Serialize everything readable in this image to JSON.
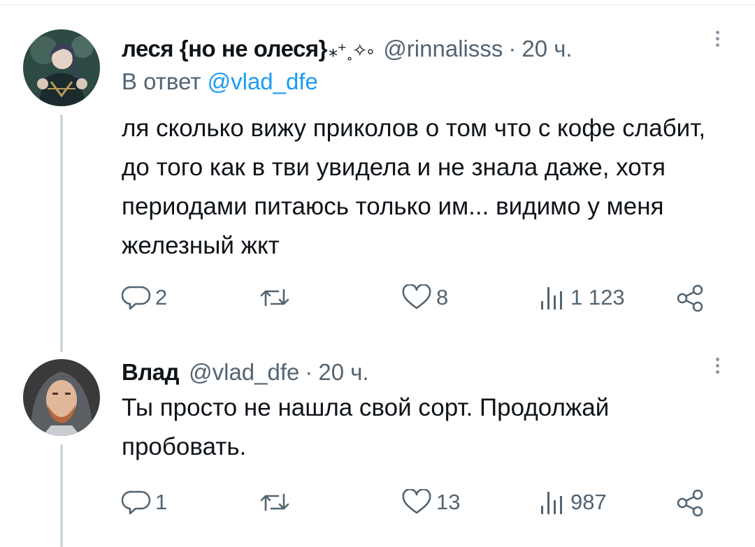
{
  "tweets": [
    {
      "display_name": "леся {но не олеся}",
      "emoji_suffix": "⁎⁺˳✧༚",
      "handle": "@rinnalisss",
      "separator": "·",
      "time": "20 ч.",
      "reply_prefix": "В ответ ",
      "reply_mention": "@vlad_dfe",
      "text": "ля сколько вижу приколов о том что с кофе слабит, до того как в тви увидела и не знала даже, хотя периодами питаюсь только им... видимо у меня железный жкт",
      "actions": {
        "replies": "2",
        "retweets": "",
        "likes": "8",
        "views": "1 123"
      }
    },
    {
      "display_name": "Влад",
      "handle": "@vlad_dfe",
      "separator": "·",
      "time": "20 ч.",
      "text": "Ты просто не нашла свой сорт. Продолжай пробовать.",
      "actions": {
        "replies": "1",
        "retweets": "",
        "likes": "13",
        "views": "987"
      }
    }
  ],
  "icons": {
    "reply": "speech-bubble-icon",
    "retweet": "retweet-icon",
    "like": "heart-icon",
    "views": "bar-chart-icon",
    "share": "share-icon",
    "more": "vertical-dots-icon"
  },
  "colors": {
    "text": "#0f1419",
    "muted": "#536471",
    "link": "#1d9bf0",
    "thread_line": "#cfd9de"
  }
}
